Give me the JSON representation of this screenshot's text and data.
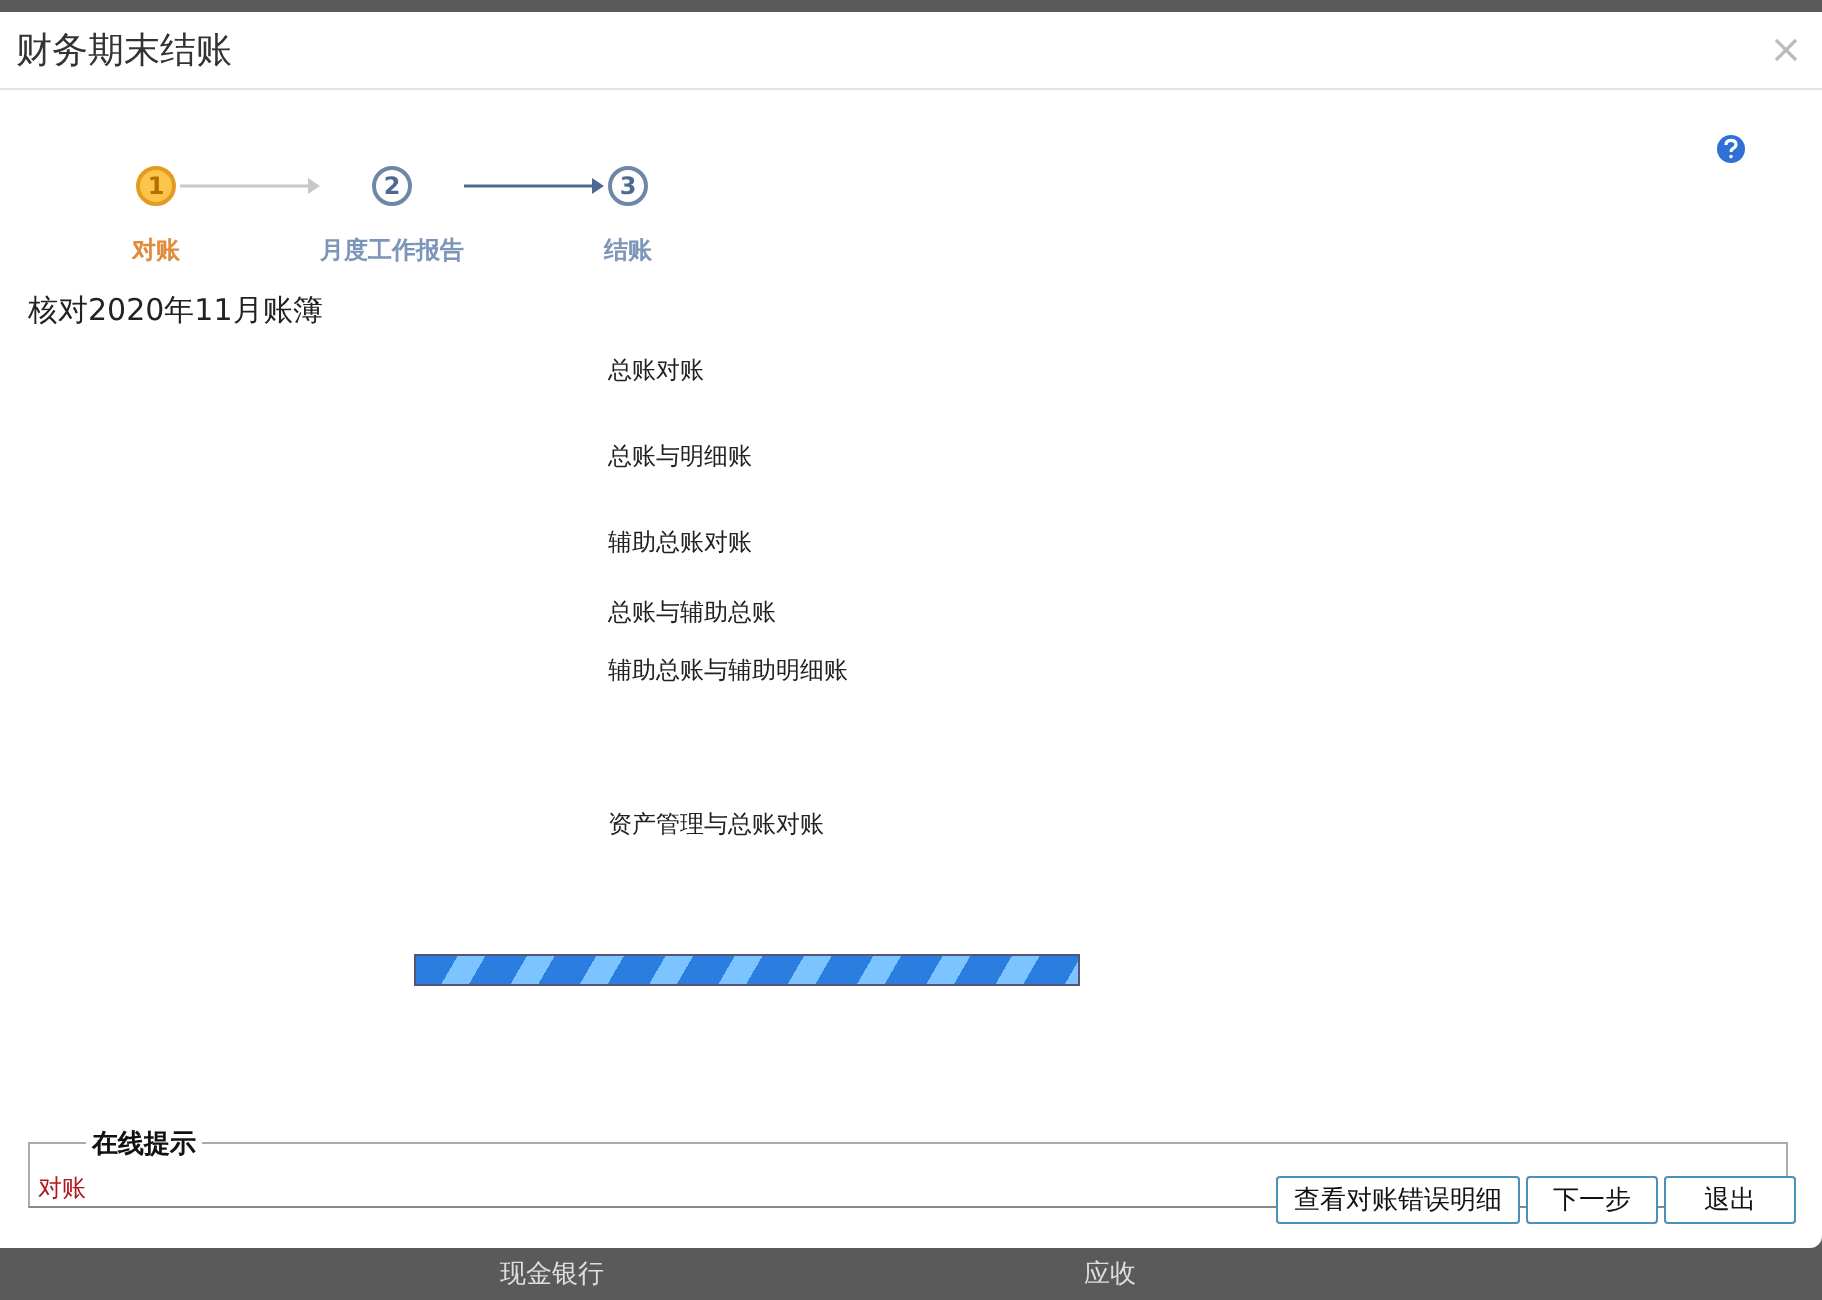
{
  "window": {
    "title": "财务期末结账"
  },
  "steps": [
    {
      "number": "1",
      "label": "对账",
      "selected": true
    },
    {
      "number": "2",
      "label": "月度工作报告",
      "selected": false
    },
    {
      "number": "3",
      "label": "结账",
      "selected": false
    }
  ],
  "heading": "核对2020年11月账簿",
  "checks": [
    "总账对账",
    "总账与明细账",
    "辅助总账对账",
    "总账与辅助总账",
    "辅助总账与辅助明细账",
    "资产管理与总账对账"
  ],
  "progress": {
    "level": 1
  },
  "hint": {
    "legend": "在线提示",
    "text": "对账"
  },
  "buttons": [
    "查看对账错误明细",
    "下一步",
    "退出"
  ],
  "background": {
    "labels": [
      "现金银行",
      "应收"
    ]
  }
}
